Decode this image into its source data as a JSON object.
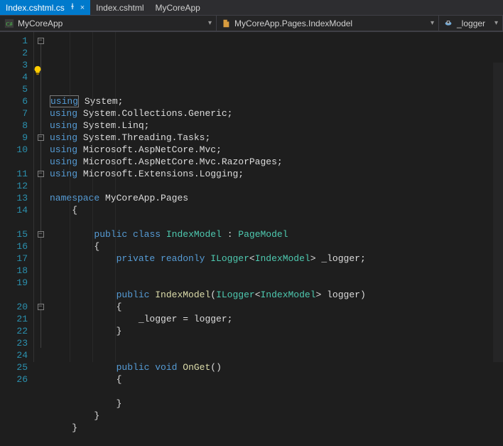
{
  "tabs": [
    {
      "label": "Index.cshtml.cs",
      "active": true,
      "pinned": true,
      "closeable": true
    },
    {
      "label": "Index.cshtml",
      "active": false
    },
    {
      "label": "MyCoreApp",
      "active": false
    }
  ],
  "nav": {
    "project": "MyCoreApp",
    "scope": "MyCoreApp.Pages.IndexModel",
    "member": "_logger"
  },
  "icons": {
    "csharp": "C#",
    "class": "class",
    "field": "field",
    "pin": "pin",
    "close": "×",
    "bulb": "💡",
    "chev": "▾"
  },
  "code": {
    "lines": [
      {
        "n": 1,
        "fold": "minus",
        "tokens": [
          [
            "kw",
            "using"
          ],
          [
            "punc",
            " "
          ],
          [
            "ident",
            "System"
          ],
          [
            "punc",
            ";"
          ]
        ],
        "boxFirst": true
      },
      {
        "n": 2,
        "tokens": [
          [
            "kw",
            "using"
          ],
          [
            "punc",
            " "
          ],
          [
            "ident",
            "System.Collections.Generic"
          ],
          [
            "punc",
            ";"
          ]
        ]
      },
      {
        "n": 3,
        "tokens": [
          [
            "kw",
            "using"
          ],
          [
            "punc",
            " "
          ],
          [
            "ident",
            "System.Linq"
          ],
          [
            "punc",
            ";"
          ]
        ]
      },
      {
        "n": 4,
        "tokens": [
          [
            "kw",
            "using"
          ],
          [
            "punc",
            " "
          ],
          [
            "ident",
            "System.Threading.Tasks"
          ],
          [
            "punc",
            ";"
          ]
        ]
      },
      {
        "n": 5,
        "tokens": [
          [
            "kw",
            "using"
          ],
          [
            "punc",
            " "
          ],
          [
            "ident",
            "Microsoft.AspNetCore.Mvc"
          ],
          [
            "punc",
            ";"
          ]
        ]
      },
      {
        "n": 6,
        "tokens": [
          [
            "kw",
            "using"
          ],
          [
            "punc",
            " "
          ],
          [
            "ident",
            "Microsoft.AspNetCore.Mvc.RazorPages"
          ],
          [
            "punc",
            ";"
          ]
        ]
      },
      {
        "n": 7,
        "tokens": [
          [
            "kw",
            "using"
          ],
          [
            "punc",
            " "
          ],
          [
            "ident",
            "Microsoft.Extensions.Logging"
          ],
          [
            "punc",
            ";"
          ]
        ]
      },
      {
        "n": 8,
        "tokens": []
      },
      {
        "n": 9,
        "fold": "minus",
        "tokens": [
          [
            "kw",
            "namespace"
          ],
          [
            "punc",
            " "
          ],
          [
            "ident",
            "MyCoreApp.Pages"
          ]
        ]
      },
      {
        "n": 10,
        "indent": 1,
        "tokens": [
          [
            "punc",
            "{"
          ]
        ]
      },
      {
        "blank": true
      },
      {
        "n": 11,
        "fold": "minus",
        "indent": 2,
        "tokens": [
          [
            "kw",
            "public"
          ],
          [
            "punc",
            " "
          ],
          [
            "kw",
            "class"
          ],
          [
            "punc",
            " "
          ],
          [
            "type",
            "IndexModel"
          ],
          [
            "punc",
            " : "
          ],
          [
            "type",
            "PageModel"
          ]
        ]
      },
      {
        "n": 12,
        "indent": 2,
        "tokens": [
          [
            "punc",
            "{"
          ]
        ]
      },
      {
        "n": 13,
        "indent": 3,
        "tokens": [
          [
            "kw",
            "private"
          ],
          [
            "punc",
            " "
          ],
          [
            "kw",
            "readonly"
          ],
          [
            "punc",
            " "
          ],
          [
            "type",
            "ILogger"
          ],
          [
            "punc",
            "<"
          ],
          [
            "type",
            "IndexModel"
          ],
          [
            "punc",
            "> "
          ],
          [
            "ident",
            "_logger"
          ],
          [
            "punc",
            ";"
          ]
        ]
      },
      {
        "n": 14,
        "indent": 3,
        "tokens": []
      },
      {
        "blank": true
      },
      {
        "n": 15,
        "fold": "minus",
        "indent": 3,
        "tokens": [
          [
            "kw",
            "public"
          ],
          [
            "punc",
            " "
          ],
          [
            "mtd",
            "IndexModel"
          ],
          [
            "punc",
            "("
          ],
          [
            "type",
            "ILogger"
          ],
          [
            "punc",
            "<"
          ],
          [
            "type",
            "IndexModel"
          ],
          [
            "punc",
            "> "
          ],
          [
            "ident",
            "logger"
          ],
          [
            "punc",
            ")"
          ]
        ]
      },
      {
        "n": 16,
        "indent": 3,
        "tokens": [
          [
            "punc",
            "{"
          ]
        ]
      },
      {
        "n": 17,
        "indent": 4,
        "tokens": [
          [
            "ident",
            "_logger"
          ],
          [
            "punc",
            " = "
          ],
          [
            "ident",
            "logger"
          ],
          [
            "punc",
            ";"
          ]
        ]
      },
      {
        "n": 18,
        "indent": 3,
        "tokens": [
          [
            "punc",
            "}"
          ]
        ]
      },
      {
        "n": 19,
        "indent": 3,
        "tokens": []
      },
      {
        "blank": true
      },
      {
        "n": 20,
        "fold": "minus",
        "indent": 3,
        "tokens": [
          [
            "kw",
            "public"
          ],
          [
            "punc",
            " "
          ],
          [
            "kw",
            "void"
          ],
          [
            "punc",
            " "
          ],
          [
            "mtd",
            "OnGet"
          ],
          [
            "punc",
            "()"
          ]
        ]
      },
      {
        "n": 21,
        "indent": 3,
        "tokens": [
          [
            "punc",
            "{"
          ]
        ]
      },
      {
        "n": 22,
        "indent": 3,
        "tokens": []
      },
      {
        "n": 23,
        "indent": 3,
        "tokens": [
          [
            "punc",
            "}"
          ]
        ]
      },
      {
        "n": 24,
        "indent": 2,
        "tokens": [
          [
            "punc",
            "}"
          ]
        ]
      },
      {
        "n": 25,
        "indent": 1,
        "tokens": [
          [
            "punc",
            "}"
          ]
        ]
      },
      {
        "n": 26,
        "tokens": []
      }
    ]
  }
}
